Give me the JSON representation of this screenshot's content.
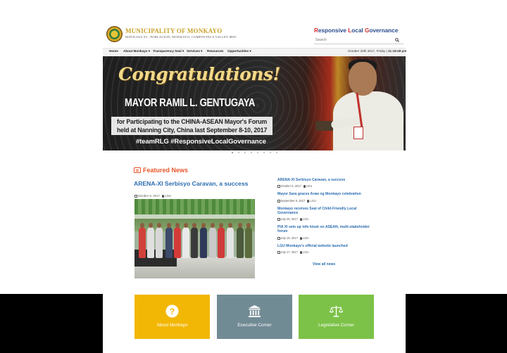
{
  "header": {
    "site_name": "MUNICIPALITY OF MONKAYO",
    "address": "MATILOSA ST., POBLACION, MONKAYO, COMPOSTELA VALLEY 8805",
    "tagline_parts": [
      "R",
      "esponsive ",
      "L",
      "ocal ",
      "G",
      "overnance"
    ],
    "search_placeholder": "Search"
  },
  "nav": {
    "items": [
      "Home",
      "About Monkayo ▾",
      "Transparency Seal ▾",
      "Services ▾",
      "Resources",
      "Opportunities ▾"
    ],
    "date_text": "October 20th 2017, Friday | ",
    "time_text": "11:18:48 pm"
  },
  "banner": {
    "headline": "Congratulations!",
    "name": "MAYOR RAMIL L. GENTUGAYA",
    "subline_1": "for Participating to the CHINA-ASEAN Mayor's Forum",
    "subline_2": "held at Nanning City, China last September 8-10, 2017",
    "hashtags": "#teamRLG #ResponsiveLocalGovernance",
    "slide_count": 8,
    "active_slide": 1
  },
  "featured": {
    "section_title": "Featured News",
    "lead": {
      "title": "ARENA-XI Serbisyo Caravan, a success",
      "date": "October 6, 2017",
      "author": "LGU"
    },
    "list": [
      {
        "title": "ARENA-XI Serbisyo Caravan, a success",
        "date": "October 6, 2017",
        "author": "LGU"
      },
      {
        "title": "Mayor Sara graces Araw ng Monkayo celebration",
        "date": "September 9, 2017",
        "author": "LGU"
      },
      {
        "title": "Monkayo receives Seal of Child-Friendly Local Governance",
        "date": "July 25, 2017",
        "author": "LGU"
      },
      {
        "title": "PIA XI sets up info kiosk on ASEAN, multi-stakeholder forum",
        "date": "July 18, 2017",
        "author": "LGU"
      },
      {
        "title": "LGU Monkaye's official website launched",
        "date": "July 17, 2017",
        "author": "LGU"
      }
    ],
    "view_all": "View all news"
  },
  "tiles": [
    {
      "label": "About Monkayo",
      "icon": "question-icon",
      "color": "#f2b705"
    },
    {
      "label": "Executive Corner",
      "icon": "institution-icon",
      "color": "#718b95"
    },
    {
      "label": "Legislative Corner",
      "icon": "scales-icon",
      "color": "#7cc248"
    }
  ],
  "colors": {
    "accent_orange": "#e8552a",
    "link_blue": "#2b6cb0",
    "logo_gold": "#c9a227"
  }
}
